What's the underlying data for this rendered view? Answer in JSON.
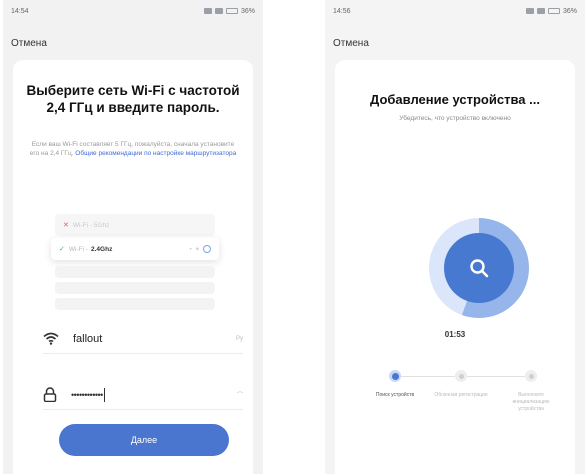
{
  "left_screen": {
    "status_time": "14:54",
    "status_right": "36%",
    "cancel_label": "Отмена",
    "title": "Выберите сеть Wi-Fi с частотой 2,4 ГГц и введите пароль.",
    "hint_text": "Если ваш Wi-Fi составляет 5 ГГц, пожалуйста, сначала установите его на 2,4 ГГц.",
    "hint_link": "Общие рекомендации по настройке маршрутизатора",
    "wifi_5g_label": "Wi-Fi - 5Ghz",
    "wifi_24_prefix": "Wi-Fi -",
    "wifi_24_label": "2.4Ghz",
    "ssid_value": "fallout",
    "ssid_right": "Ру",
    "password_masked": "••••••••••••",
    "next_button": "Далее",
    "icons": {
      "wifi": "wifi-icon",
      "lock": "lock-icon"
    }
  },
  "right_screen": {
    "status_time": "14:56",
    "status_right": "36%",
    "cancel_label": "Отмена",
    "title": "Добавление устройства ...",
    "subtitle": "Убедитесь, что устройство включено",
    "timer": "01:53",
    "steps": [
      {
        "label": "Поиск устройств",
        "active": true
      },
      {
        "label": "Облачная регистрация",
        "active": false
      },
      {
        "label": "Выполните инициализацию устройства",
        "active": false
      }
    ]
  },
  "colors": {
    "accent": "#4a76d0",
    "radar_light": "#dbe6fa",
    "radar_dark": "#4779d0",
    "link": "#3d6bd6"
  }
}
